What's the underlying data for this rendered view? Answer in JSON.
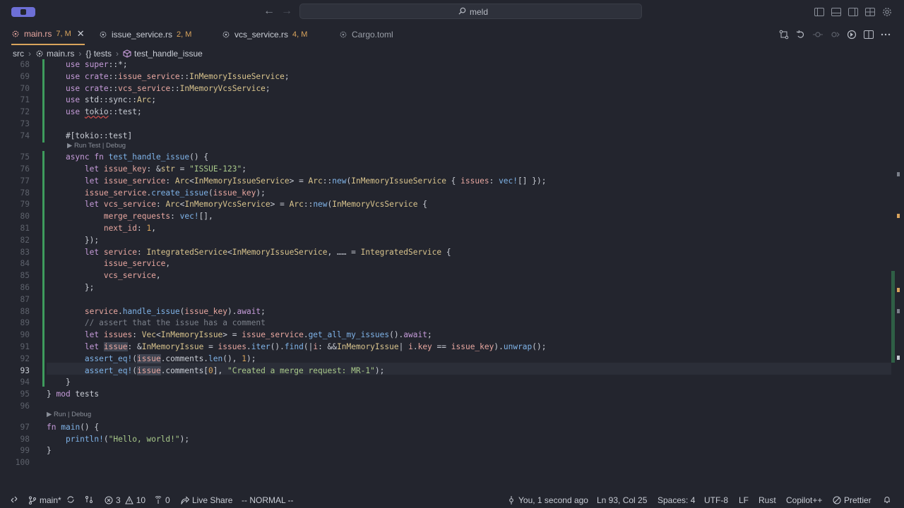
{
  "window": {
    "search_text": "meld"
  },
  "tabs": [
    {
      "name": "main.rs",
      "mod": "7, M",
      "active": true,
      "close": "✕"
    },
    {
      "name": "issue_service.rs",
      "mod": "2, M"
    },
    {
      "name": "vcs_service.rs",
      "mod": "4, M"
    },
    {
      "name": "Cargo.toml",
      "mod": ""
    }
  ],
  "breadcrumb": [
    "src",
    "main.rs",
    "{} tests",
    "test_handle_issue"
  ],
  "editor": {
    "code_lens_test": "▶ Run Test | Debug",
    "code_lens_main": "▶ Run | Debug",
    "current_line": 93,
    "lines": [
      {
        "n": "68",
        "t": "    use super::*;"
      },
      {
        "n": "69",
        "t": "    use crate::issue_service::InMemoryIssueService;"
      },
      {
        "n": "70",
        "t": "    use crate::vcs_service::InMemoryVcsService;"
      },
      {
        "n": "71",
        "t": "    use std::sync::Arc;"
      },
      {
        "n": "72",
        "t": "    use tokio::test;"
      },
      {
        "n": "73",
        "t": ""
      },
      {
        "n": "74",
        "t": "    #[tokio::test]"
      },
      {
        "n": "75",
        "t": "    async fn test_handle_issue() {"
      },
      {
        "n": "76",
        "t": "        let issue_key: &str = \"ISSUE-123\";"
      },
      {
        "n": "77",
        "t": "        let issue_service: Arc<InMemoryIssueService> = Arc::new(InMemoryIssueService { issues: vec![] });"
      },
      {
        "n": "78",
        "t": "        issue_service.create_issue(issue_key);"
      },
      {
        "n": "79",
        "t": "        let vcs_service: Arc<InMemoryVcsService> = Arc::new(InMemoryVcsService {"
      },
      {
        "n": "80",
        "t": "            merge_requests: vec![],"
      },
      {
        "n": "81",
        "t": "            next_id: 1,"
      },
      {
        "n": "82",
        "t": "        });"
      },
      {
        "n": "83",
        "t": "        let service: IntegratedService<InMemoryIssueService, …… = IntegratedService {"
      },
      {
        "n": "84",
        "t": "            issue_service,"
      },
      {
        "n": "85",
        "t": "            vcs_service,"
      },
      {
        "n": "86",
        "t": "        };"
      },
      {
        "n": "87",
        "t": ""
      },
      {
        "n": "88",
        "t": "        service.handle_issue(issue_key).await;"
      },
      {
        "n": "89",
        "t": "        // assert that the issue has a comment"
      },
      {
        "n": "90",
        "t": "        let issues: Vec<InMemoryIssue> = issue_service.get_all_my_issues().await;"
      },
      {
        "n": "91",
        "t": "        let issue: &InMemoryIssue = issues.iter().find(|i: &&InMemoryIssue| i.key == issue_key).unwrap();"
      },
      {
        "n": "92",
        "t": "        assert_eq!(issue.comments.len(), 1);"
      },
      {
        "n": "93",
        "t": "        assert_eq!(issue.comments[0], \"Created a merge request: MR-1\");"
      },
      {
        "n": "94",
        "t": "    }"
      },
      {
        "n": "95",
        "t": "} mod tests"
      },
      {
        "n": "96",
        "t": ""
      },
      {
        "n": "97",
        "t": "fn main() {"
      },
      {
        "n": "98",
        "t": "    println!(\"Hello, world!\");"
      },
      {
        "n": "99",
        "t": "}"
      },
      {
        "n": "100",
        "t": ""
      }
    ]
  },
  "statusbar": {
    "branch": "main*",
    "errors": "3",
    "warnings": "10",
    "info": "0",
    "live_share": "Live Share",
    "mode": "-- NORMAL --",
    "blame": "You, 1 second ago",
    "position": "Ln 93, Col 25",
    "spaces": "Spaces: 4",
    "encoding": "UTF-8",
    "eol": "LF",
    "language": "Rust",
    "copilot": "Copilot++",
    "prettier": "Prettier"
  },
  "colors": {
    "background": "#23252e",
    "accent": "#d9a45c",
    "modified_bar": "#3e9b5c"
  }
}
